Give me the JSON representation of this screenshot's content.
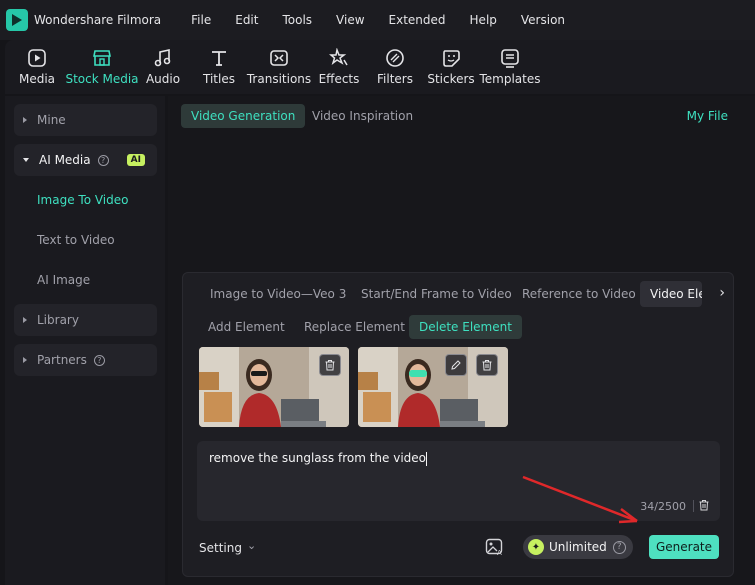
{
  "app": {
    "title": "Wondershare Filmora"
  },
  "menu": [
    "File",
    "Edit",
    "Tools",
    "View",
    "Extended",
    "Help",
    "Version"
  ],
  "toolbar": {
    "items": [
      {
        "label": "Media",
        "icon": "media-icon"
      },
      {
        "label": "Stock Media",
        "icon": "stock-media-icon"
      },
      {
        "label": "Audio",
        "icon": "music-note-icon"
      },
      {
        "label": "Titles",
        "icon": "text-icon"
      },
      {
        "label": "Transitions",
        "icon": "transitions-icon"
      },
      {
        "label": "Effects",
        "icon": "effects-icon"
      },
      {
        "label": "Filters",
        "icon": "filters-icon"
      },
      {
        "label": "Stickers",
        "icon": "stickers-icon"
      },
      {
        "label": "Templates",
        "icon": "templates-icon"
      }
    ],
    "active": "Stock Media"
  },
  "sidebar": {
    "mine": "Mine",
    "ai_media": "AI Media",
    "ai_badge": "AI",
    "sub_items": [
      "Image To Video",
      "Text to Video",
      "AI Image"
    ],
    "library": "Library",
    "partners": "Partners"
  },
  "main": {
    "tabs": [
      "Video Generation",
      "Video Inspiration"
    ],
    "my_file": "My File",
    "mode_tabs": [
      "Image to Video—Veo 3",
      "Start/End Frame to Video",
      "Reference to Video",
      "Video Elements"
    ],
    "sub_tabs": [
      "Add Element",
      "Replace Element",
      "Delete Element"
    ],
    "prompt": "remove the sunglass from the video",
    "counter": "34/2500",
    "setting": "Setting",
    "unlimited": "Unlimited",
    "generate": "Generate"
  },
  "colors": {
    "accent": "#3ee0c0",
    "generate_bg": "#4ee0c0",
    "ai_badge": "#c6f060",
    "arrow": "#e0282a"
  }
}
